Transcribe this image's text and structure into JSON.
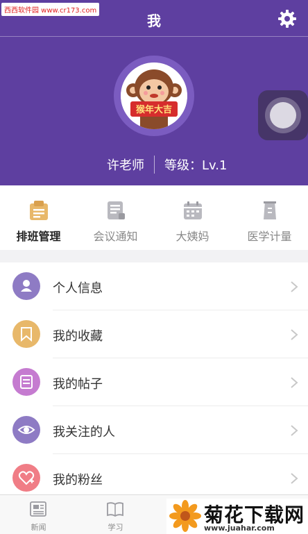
{
  "watermark_top": "西西软件园 www.cr173.com",
  "header": {
    "title": "我"
  },
  "profile": {
    "name": "许老师",
    "level": "等级：Lv.1",
    "avatar_banner": "猴年大吉"
  },
  "quick_actions": [
    {
      "label": "排班管理",
      "icon": "schedule-icon",
      "active": true
    },
    {
      "label": "会议通知",
      "icon": "meeting-notice-icon",
      "active": false
    },
    {
      "label": "大姨妈",
      "icon": "calendar-icon",
      "active": false
    },
    {
      "label": "医学计量",
      "icon": "measure-cup-icon",
      "active": false
    }
  ],
  "menu": [
    {
      "label": "个人信息",
      "icon": "person-icon",
      "color": "#8e7bc4"
    },
    {
      "label": "我的收藏",
      "icon": "bookmark-icon",
      "color": "#e8b86a"
    },
    {
      "label": "我的帖子",
      "icon": "post-icon",
      "color": "#c57bd0"
    },
    {
      "label": "我关注的人",
      "icon": "eye-icon",
      "color": "#8e7bc4"
    },
    {
      "label": "我的粉丝",
      "icon": "heart-plus-icon",
      "color": "#f07d86"
    }
  ],
  "tabbar": [
    {
      "label": "新闻",
      "icon": "news-icon"
    },
    {
      "label": "学习",
      "icon": "book-icon"
    }
  ],
  "watermark_bottom": {
    "text": "菊花下载网",
    "url": "www.juahar.com"
  },
  "colors": {
    "primary": "#5e3fa0",
    "background": "#f2f2f4"
  }
}
